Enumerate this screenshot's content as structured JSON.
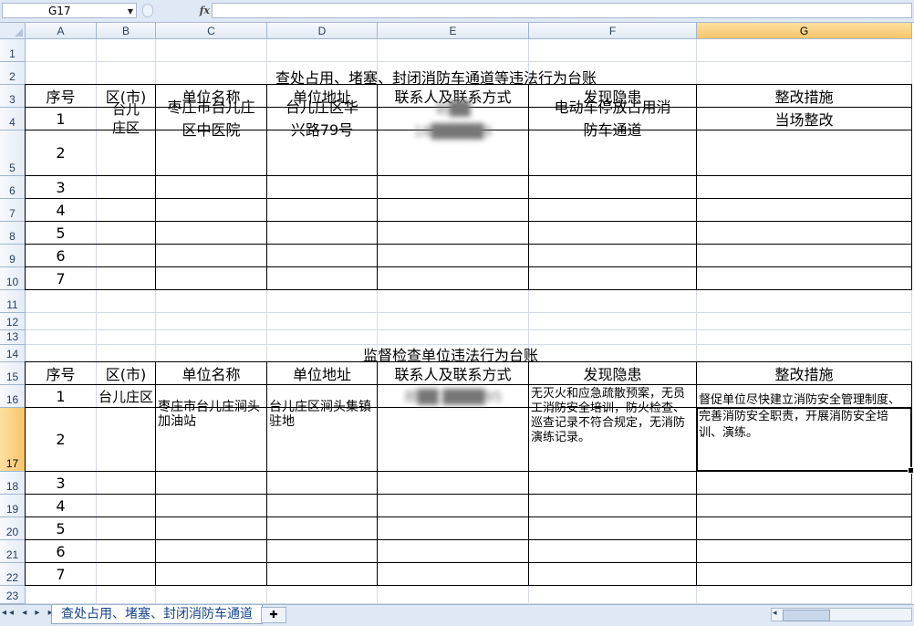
{
  "formula_bar": {
    "name_box": "G17",
    "fx_label": "fx",
    "formula": ""
  },
  "columns": [
    "A",
    "B",
    "C",
    "D",
    "E",
    "F",
    "G"
  ],
  "rows": [
    "1",
    "2",
    "3",
    "4",
    "5",
    "6",
    "7",
    "8",
    "9",
    "10",
    "11",
    "12",
    "13",
    "14",
    "15",
    "16",
    "17",
    "18",
    "19",
    "20",
    "21",
    "22",
    "23"
  ],
  "table1": {
    "title": "查处占用、堵塞、封闭消防车通道等违法行为台账",
    "headers": [
      "序号",
      "区(市)",
      "单位名称",
      "单位地址",
      "联系人及联系方式",
      "发现隐患",
      "整改措施"
    ],
    "row1": {
      "seq": "1",
      "district": "台儿庄区",
      "unit_name": "枣庄市台儿庄区中医院",
      "address": "台儿庄区华兴路79号",
      "contact_line1": "耿██",
      "contact_line2": "18█████9",
      "hazard": "电动车停放占用消防车通道",
      "measure": "当场整改"
    },
    "seqs": [
      "2",
      "3",
      "4",
      "5",
      "6",
      "7"
    ]
  },
  "table2": {
    "title": "监督检查单位违法行为台账",
    "headers": [
      "序号",
      "区(市)",
      "单位名称",
      "单位地址",
      "联系人及联系方式",
      "发现隐患",
      "整改措施"
    ],
    "row1": {
      "seq": "1",
      "district": "台儿庄区",
      "unit_name": "枣庄市台儿庄涧头加油站",
      "address": "台儿庄区涧头集镇驻地",
      "contact": "郑██ ████95",
      "hazard": "无灭火和应急疏散预案，无员工消防安全培训，防火检查、巡查记录不符合规定，无消防演练记录。",
      "measure": "督促单位尽快建立消防安全管理制度、完善消防安全职责，开展消防安全培训、演练。"
    },
    "seqs": [
      "2",
      "3",
      "4",
      "5",
      "6",
      "7"
    ]
  },
  "sheet_tabs": {
    "active": "查处占用、堵塞、封闭消防车通道"
  },
  "selected_column": "G",
  "selected_row": "17"
}
